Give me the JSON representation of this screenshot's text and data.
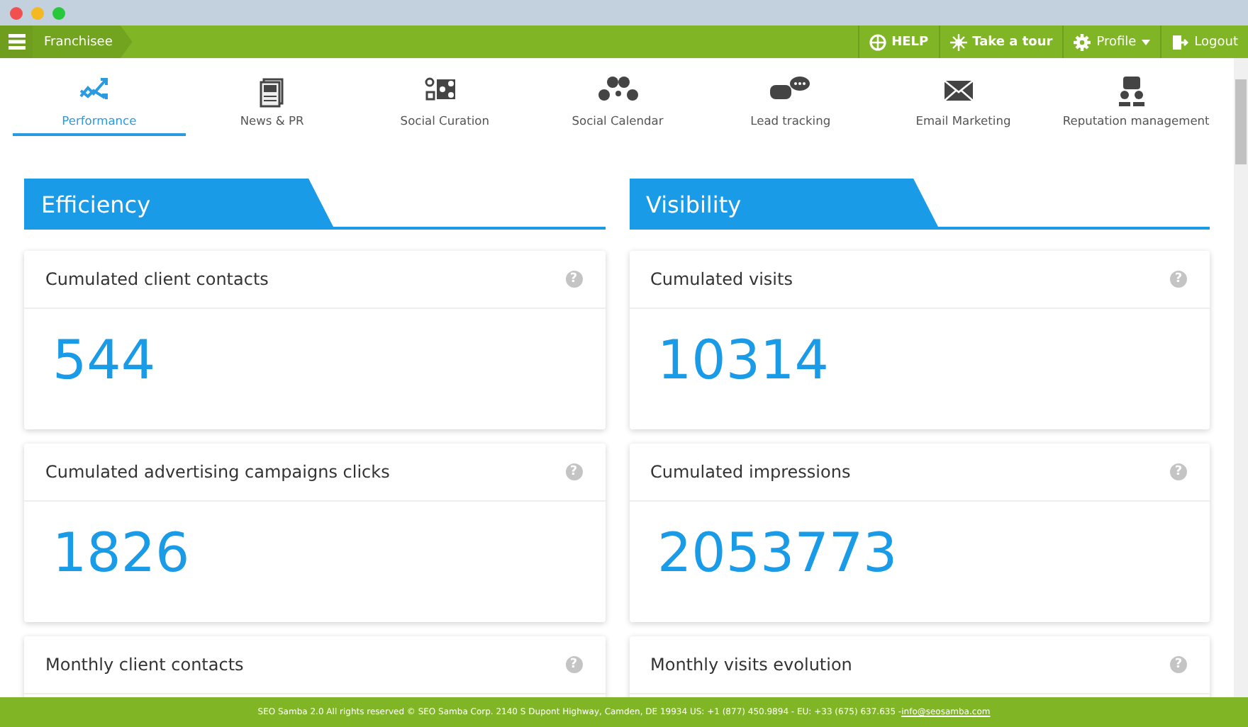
{
  "topbar": {
    "breadcrumb": "Franchisee",
    "actions": [
      {
        "kind": "help",
        "label": "HELP"
      },
      {
        "kind": "tour",
        "label": "Take a tour"
      },
      {
        "kind": "profile",
        "label": "Profile"
      },
      {
        "kind": "logout",
        "label": "Logout"
      }
    ]
  },
  "tabs": [
    {
      "kind": "performance",
      "label": "Performance",
      "selected": true
    },
    {
      "kind": "news",
      "label": "News & PR",
      "selected": false
    },
    {
      "kind": "curation",
      "label": "Social Curation",
      "selected": false
    },
    {
      "kind": "calendar",
      "label": "Social Calendar",
      "selected": false
    },
    {
      "kind": "lead",
      "label": "Lead tracking",
      "selected": false
    },
    {
      "kind": "email",
      "label": "Email Marketing",
      "selected": false
    },
    {
      "kind": "reputation",
      "label": "Reputation management",
      "selected": false
    }
  ],
  "sections": [
    {
      "title": "Efficiency",
      "cards": [
        {
          "title": "Cumulated client contacts",
          "value": "544",
          "hint": "?"
        },
        {
          "title": "Cumulated advertising campaigns clicks",
          "value": "1826",
          "hint": "?"
        },
        {
          "title": "Monthly client contacts",
          "hint": "?"
        }
      ]
    },
    {
      "title": "Visibility",
      "cards": [
        {
          "title": "Cumulated visits",
          "value": "10314",
          "hint": "?"
        },
        {
          "title": "Cumulated impressions",
          "value": "2053773",
          "hint": "?"
        },
        {
          "title": "Monthly visits evolution",
          "hint": "?"
        }
      ]
    }
  ],
  "footer": {
    "text": "SEO Samba 2.0  All rights reserved © SEO Samba Corp. 2140 S Dupont Highway, Camden, DE 19934 US: +1 (877) 450.9894 - EU: +33 (675) 637.635 - ",
    "link": "info@seosamba.com"
  }
}
